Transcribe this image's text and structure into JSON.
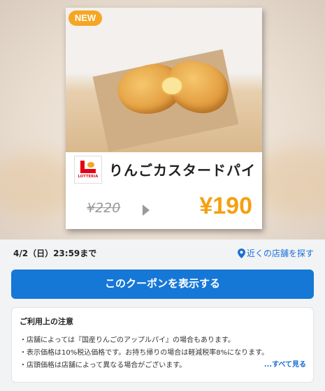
{
  "coupon": {
    "badge": "NEW",
    "brand_logo_text": "LOTTERIA",
    "product_name": "りんごカスタードパイ",
    "old_price": "¥220",
    "new_price": "¥190"
  },
  "validity": {
    "expiry": "4/2（日）23:59まで"
  },
  "nearby": {
    "label": "近くの店舗を探す"
  },
  "cta": {
    "label": "このクーポンを表示する"
  },
  "notes": {
    "title": "ご利用上の注意",
    "items": [
      "・店舗によっては『国産りんごのアップルパイ』の場合もあります。",
      "・表示価格は10%税込価格です。お持ち帰りの場合は軽減税率8%になります。",
      "・店頭価格は店舗によって異なる場合がございます。"
    ],
    "see_all": "...すべて見る"
  },
  "colors": {
    "accent_blue": "#1577d6",
    "price_orange": "#f5a012",
    "badge_orange": "#f5a623",
    "brand_red": "#e60012"
  }
}
